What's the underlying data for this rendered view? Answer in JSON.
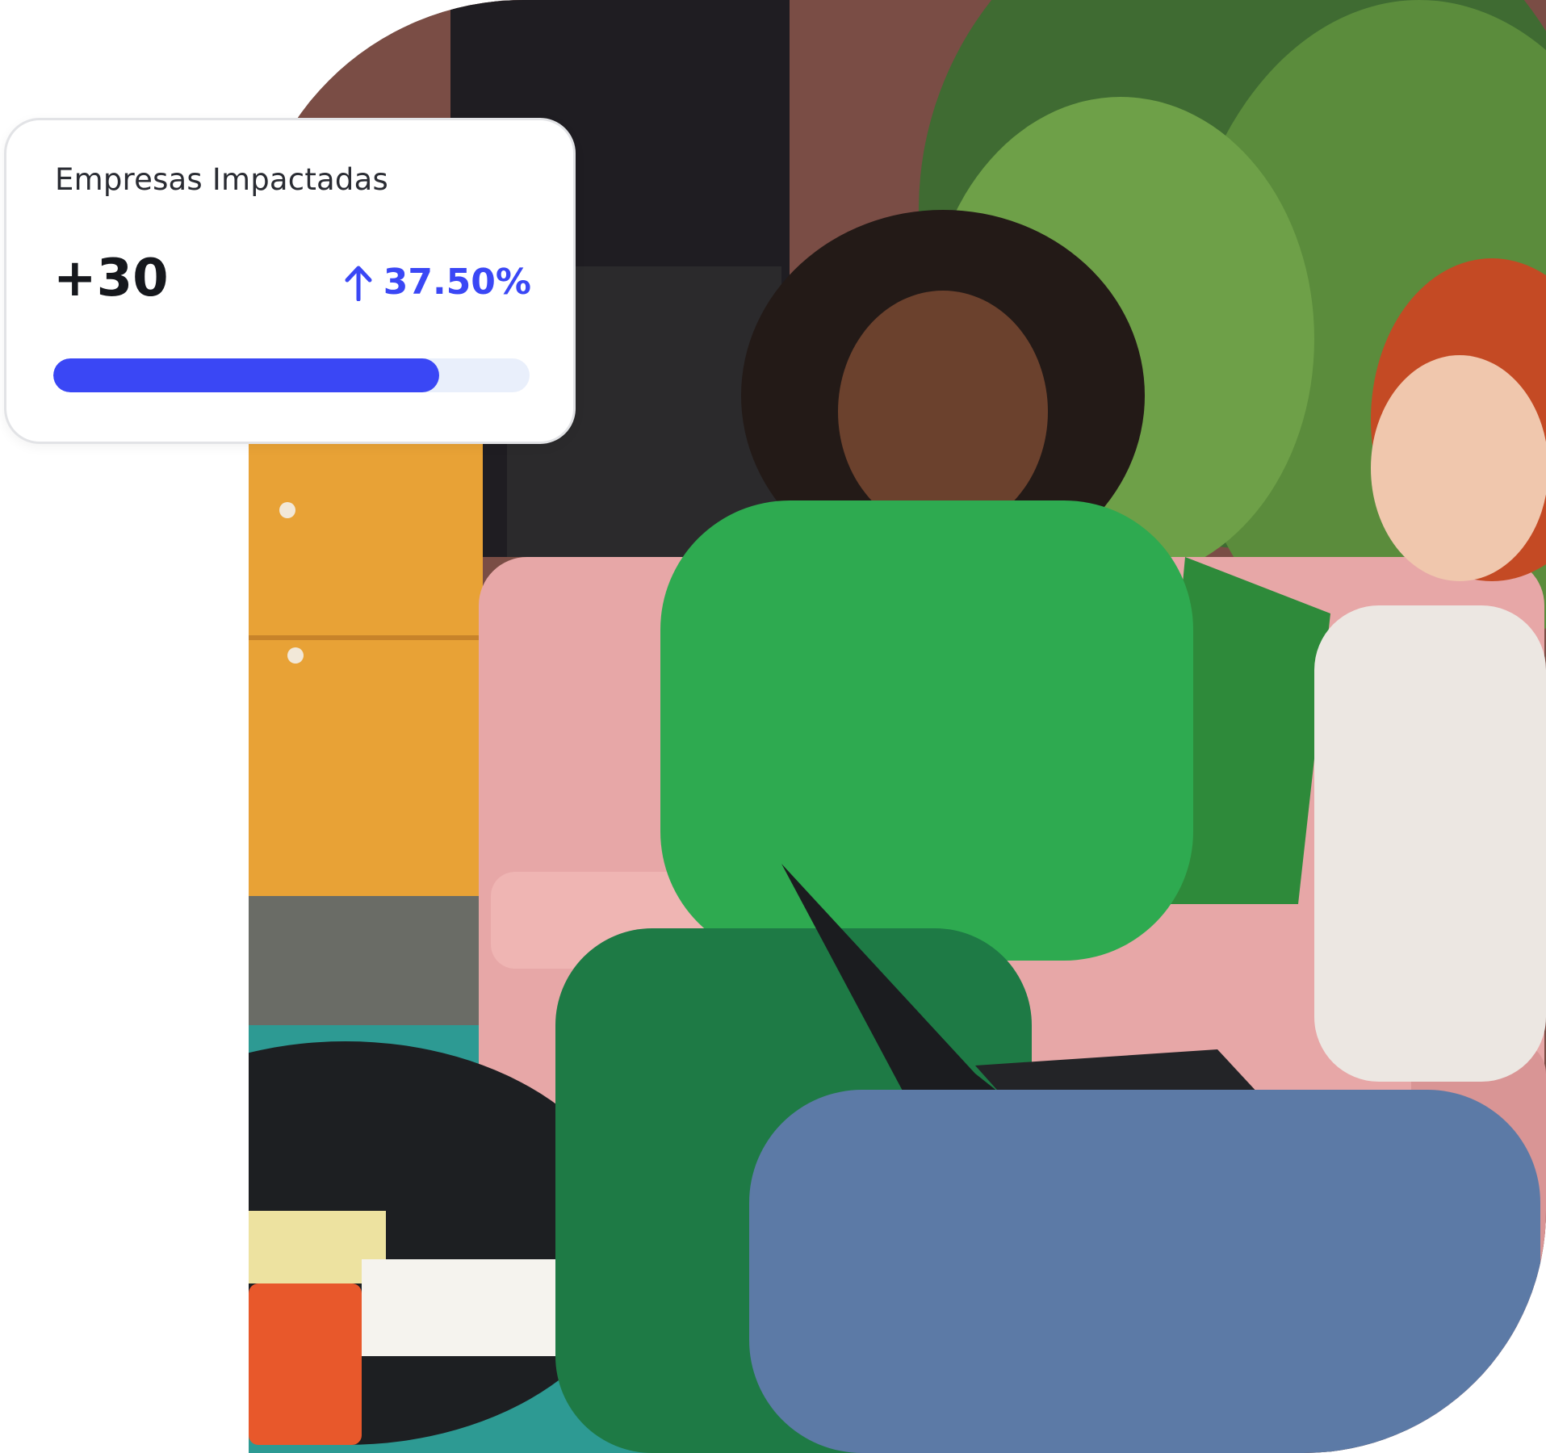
{
  "stat_card": {
    "title": "Empresas Impactadas",
    "value": "+30",
    "change_label": "37.50%",
    "change_direction_icon": "arrow-up-icon",
    "progress_fraction": 0.81
  },
  "colors": {
    "accent": "#3a47f5",
    "progress_track": "#e9effb",
    "card_border": "#e2e3e6",
    "text_dark": "#16181d"
  }
}
